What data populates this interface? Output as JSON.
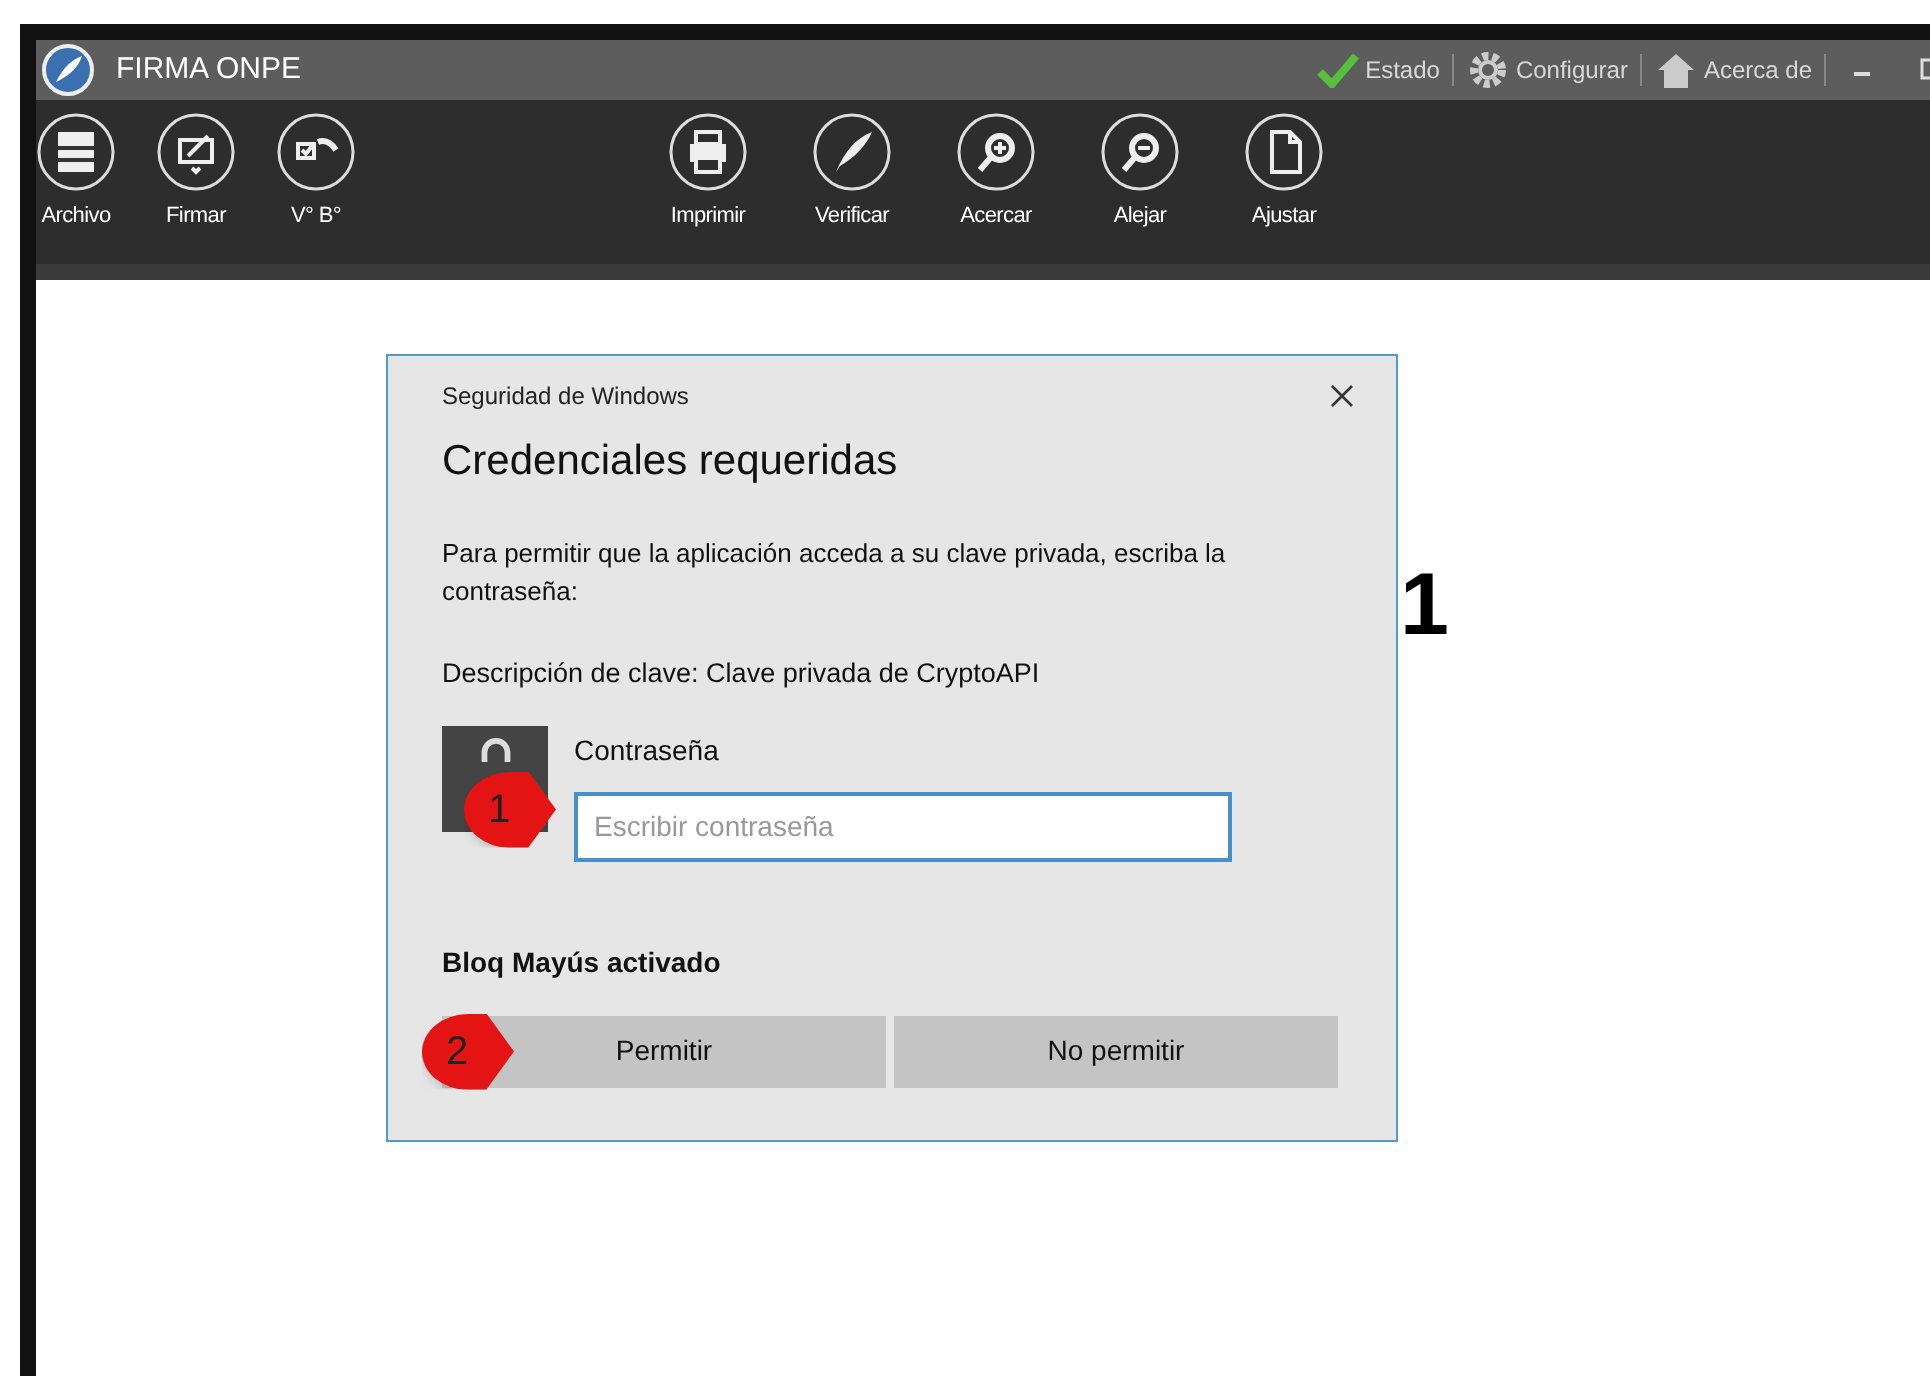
{
  "window": {
    "title": "FIRMA ONPE",
    "menu": [
      {
        "label": "Estado"
      },
      {
        "label": "Configurar"
      },
      {
        "label": "Acerca de"
      }
    ]
  },
  "toolbar": {
    "left": [
      {
        "label": "Archivo"
      },
      {
        "label": "Firmar"
      },
      {
        "label": "V° B°"
      }
    ],
    "right": [
      {
        "label": "Imprimir"
      },
      {
        "label": "Verificar"
      },
      {
        "label": "Acercar"
      },
      {
        "label": "Alejar"
      },
      {
        "label": "Ajustar"
      }
    ]
  },
  "document": {
    "text": "1"
  },
  "dialog": {
    "caption": "Seguridad de Windows",
    "title": "Credenciales requeridas",
    "message": "Para permitir que la aplicación acceda a su clave privada, escriba la contraseña:",
    "key_description": "Descripción de clave: Clave privada de CryptoAPI",
    "field_label": "Contraseña",
    "placeholder": "Escribir contraseña",
    "warning": "Bloq Mayús activado",
    "buttons": [
      "Permitir",
      "No permitir"
    ]
  },
  "callouts": [
    {
      "label": "1"
    },
    {
      "label": "2"
    }
  ]
}
